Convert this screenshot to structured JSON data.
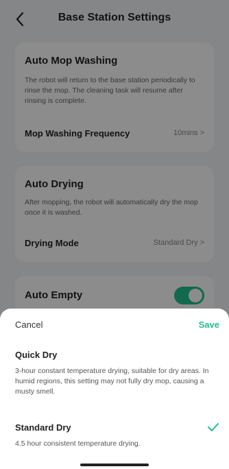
{
  "header": {
    "title": "Base Station Settings"
  },
  "auto_mop_washing": {
    "title": "Auto Mop Washing",
    "description": "The robot will return to the base station periodically to rinse the mop. The cleaning task will resume after rinsing is complete.",
    "frequency_label": "Mop Washing Frequency",
    "frequency_value": "10mins >"
  },
  "auto_drying": {
    "title": "Auto Drying",
    "description": "After mopping, the robot will automatically dry the mop once it is washed.",
    "mode_label": "Drying Mode",
    "mode_value": "Standard Dry >"
  },
  "auto_empty": {
    "title": "Auto Empty",
    "enabled": true
  },
  "sheet": {
    "cancel_label": "Cancel",
    "save_label": "Save",
    "options": [
      {
        "title": "Quick Dry",
        "description": "3-hour constant temperature drying, suitable for dry areas. In humid regions, this setting may not fully dry mop, causing a musty smell.",
        "selected": false
      },
      {
        "title": "Standard Dry",
        "description": "4.5 hour consistent temperature drying.",
        "selected": true
      }
    ]
  },
  "colors": {
    "accent": "#1fbf8f",
    "overlay": "rgba(0,0,0,0.45)"
  },
  "icons": {
    "back": "chevron-left-icon",
    "check": "check-icon"
  }
}
